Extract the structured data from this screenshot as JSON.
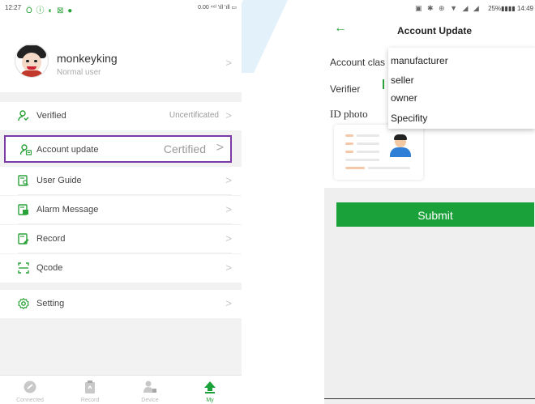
{
  "left": {
    "status_time": "12:27",
    "status_icons": "Ö ⓘ ◐ ⊠ ●",
    "status_right": "0.00 ⁴⁶ᴵ 'ıll 'ıll ▭",
    "profile": {
      "name": "monkeyking",
      "role": "Normal user"
    },
    "menu": [
      {
        "label": "Verified",
        "value": "Uncertificated",
        "icon": "person-check-icon"
      },
      {
        "label": "Account update",
        "value": "Certified",
        "icon": "account-update-icon"
      },
      {
        "label": "User Guide",
        "value": "",
        "icon": "document-search-icon"
      },
      {
        "label": "Alarm Message",
        "value": "",
        "icon": "message-icon"
      },
      {
        "label": "Record",
        "value": "",
        "icon": "record-edit-icon"
      },
      {
        "label": "Qcode",
        "value": "",
        "icon": "qr-scan-icon"
      },
      {
        "label": "Setting",
        "value": "",
        "icon": "gear-icon"
      }
    ],
    "chevron": ">",
    "tabs": [
      {
        "label": "Connected",
        "icon": "link-icon"
      },
      {
        "label": "Record",
        "icon": "clipboard-icon"
      },
      {
        "label": "Device",
        "icon": "device-user-icon"
      },
      {
        "label": "My",
        "icon": "upload-arrow-icon"
      }
    ]
  },
  "right": {
    "status_text": "25%▮▮▮▮ 14:49",
    "status_icons": "▣ ✱ ⊕ ▼ ◢ ◢",
    "back_glyph": "←",
    "title": "Account Update",
    "form": {
      "account_class_label": "Account clas",
      "verifier_label": "Verifier",
      "id_photo_label": "ID photo"
    },
    "dropdown_options": [
      "manufacturer",
      "seller",
      "owner",
      "Specifity"
    ],
    "submit_label": "Submit"
  },
  "colors": {
    "accent_green": "#1aa13a",
    "highlight_purple": "#7b3aa5"
  }
}
